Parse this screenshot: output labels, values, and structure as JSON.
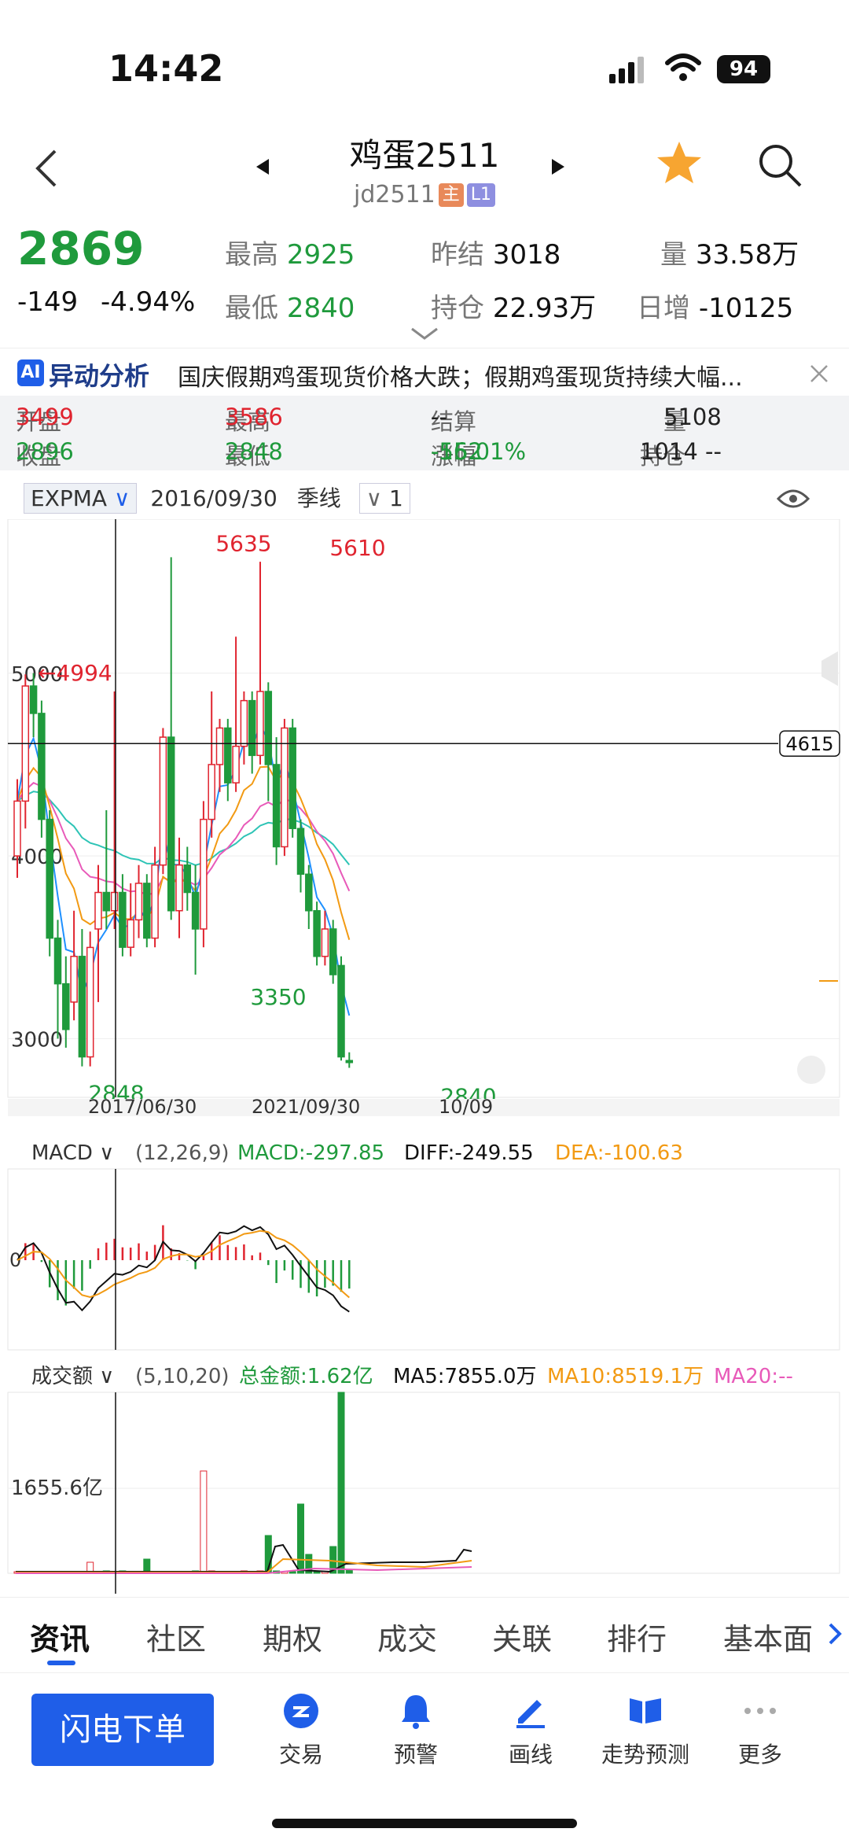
{
  "status_bar": {
    "time": "14:42",
    "battery": "94"
  },
  "header": {
    "title": "鸡蛋2511",
    "code": "jd2511",
    "tag_main": "主",
    "tag_l1": "L1"
  },
  "quote": {
    "price": "2869",
    "change": "-149",
    "change_pct": "-4.94%",
    "high_label": "最高",
    "high": "2925",
    "low_label": "最低",
    "low": "2840",
    "prev_settle_label": "昨结",
    "prev_settle": "3018",
    "open_interest_label": "持仓",
    "open_interest": "22.93万",
    "volume_label": "量",
    "volume": "33.58万",
    "daily_add_label": "日增",
    "daily_add": "-10125"
  },
  "news": {
    "ai_badge": "AI",
    "label": "异动分析",
    "text": "国庆假期鸡蛋现货价格大跌；假期鸡蛋现货持续大幅..."
  },
  "crosshair_stats": {
    "open_label": "开盘",
    "open": "3499",
    "high_label": "最高",
    "high": "3586",
    "settle_label": "结算",
    "settle": "--",
    "volume_label": "量",
    "volume": "5108",
    "close_label": "收盘",
    "close": "2896",
    "low_label": "最低",
    "low": "2848",
    "change_label": "涨幅",
    "change": "-552",
    "change_pct": "-16.01%",
    "oi_label": "持仓",
    "oi": "1014 --"
  },
  "chart_toolbar": {
    "indicator": "EXPMA",
    "date": "2016/09/30",
    "period": "季线",
    "multiplier": "1"
  },
  "chart_data": {
    "type": "candlestick",
    "title": "",
    "ylim": [
      2700,
      5800
    ],
    "y_ticks": [
      "5000",
      "4000",
      "3000"
    ],
    "x_ticks": [
      "2017/06/30",
      "2021/09/30",
      "10/09"
    ],
    "annotations": {
      "high1": "5635",
      "high2": "5610",
      "left_high": "4994",
      "mid_low": "3350",
      "left_low": "2848",
      "right_low": "2840",
      "crosshair_value": "4615"
    },
    "crosshair_value": 4615,
    "candles": [
      {
        "o": 4000,
        "c": 4300,
        "h": 4420,
        "l": 3880
      },
      {
        "o": 4300,
        "c": 4930,
        "h": 4994,
        "l": 4150
      },
      {
        "o": 4930,
        "c": 4780,
        "h": 5000,
        "l": 4650
      },
      {
        "o": 4780,
        "c": 4200,
        "h": 4850,
        "l": 4100
      },
      {
        "o": 4200,
        "c": 3550,
        "h": 4250,
        "l": 3450
      },
      {
        "o": 3550,
        "c": 3300,
        "h": 3650,
        "l": 3000
      },
      {
        "o": 3300,
        "c": 3050,
        "h": 3450,
        "l": 2950
      },
      {
        "o": 3200,
        "c": 3450,
        "h": 3700,
        "l": 3100
      },
      {
        "o": 3450,
        "c": 2900,
        "h": 3600,
        "l": 2848
      },
      {
        "o": 2900,
        "c": 3499,
        "h": 3586,
        "l": 2848
      },
      {
        "o": 3600,
        "c": 3800,
        "h": 3950,
        "l": 3200
      },
      {
        "o": 3800,
        "c": 3700,
        "h": 4250,
        "l": 3600
      },
      {
        "o": 3700,
        "c": 3800,
        "h": 4900,
        "l": 3600
      },
      {
        "o": 3800,
        "c": 3500,
        "h": 3900,
        "l": 3450
      },
      {
        "o": 3500,
        "c": 3650,
        "h": 3850,
        "l": 3450
      },
      {
        "o": 3650,
        "c": 3850,
        "h": 3950,
        "l": 3550
      },
      {
        "o": 3850,
        "c": 3550,
        "h": 3900,
        "l": 3500
      },
      {
        "o": 3550,
        "c": 3950,
        "h": 4050,
        "l": 3500
      },
      {
        "o": 3950,
        "c": 4650,
        "h": 4700,
        "l": 3900
      },
      {
        "o": 4650,
        "c": 3700,
        "h": 5635,
        "l": 3650
      },
      {
        "o": 3700,
        "c": 3950,
        "h": 4100,
        "l": 3550
      },
      {
        "o": 3950,
        "c": 3800,
        "h": 4050,
        "l": 3700
      },
      {
        "o": 3800,
        "c": 3600,
        "h": 3950,
        "l": 3350
      },
      {
        "o": 3600,
        "c": 4200,
        "h": 4300,
        "l": 3500
      },
      {
        "o": 4200,
        "c": 4500,
        "h": 4900,
        "l": 4100
      },
      {
        "o": 4500,
        "c": 4700,
        "h": 4750,
        "l": 4350
      },
      {
        "o": 4700,
        "c": 4400,
        "h": 4750,
        "l": 4300
      },
      {
        "o": 4400,
        "c": 4600,
        "h": 5200,
        "l": 4350
      },
      {
        "o": 4600,
        "c": 4850,
        "h": 4900,
        "l": 4500
      },
      {
        "o": 4850,
        "c": 4550,
        "h": 4900,
        "l": 4450
      },
      {
        "o": 4550,
        "c": 4900,
        "h": 5610,
        "l": 4500
      },
      {
        "o": 4900,
        "c": 4500,
        "h": 4950,
        "l": 4300
      },
      {
        "o": 4500,
        "c": 4050,
        "h": 4650,
        "l": 3950
      },
      {
        "o": 4050,
        "c": 4700,
        "h": 4750,
        "l": 4000
      },
      {
        "o": 4700,
        "c": 4150,
        "h": 4750,
        "l": 4100
      },
      {
        "o": 4150,
        "c": 3900,
        "h": 4200,
        "l": 3800
      },
      {
        "o": 3900,
        "c": 3700,
        "h": 3950,
        "l": 3600
      },
      {
        "o": 3700,
        "c": 3450,
        "h": 3750,
        "l": 3400
      },
      {
        "o": 3450,
        "c": 3600,
        "h": 3700,
        "l": 3400
      },
      {
        "o": 3600,
        "c": 3350,
        "h": 3650,
        "l": 3300
      },
      {
        "o": 3400,
        "c": 2900,
        "h": 3450,
        "l": 2880
      },
      {
        "o": 2880,
        "c": 2869,
        "h": 2925,
        "l": 2840
      }
    ]
  },
  "macd": {
    "label": "MACD",
    "params": "(12,26,9)",
    "macd": "MACD:-297.85",
    "diff": "DIFF:-249.55",
    "dea": "DEA:-100.63",
    "zero": "0"
  },
  "volume_panel": {
    "label": "成交额",
    "params": "(5,10,20)",
    "total": "总金额:1.62亿",
    "ma5": "MA5:7855.0万",
    "ma10": "MA10:8519.1万",
    "ma20": "MA20:--",
    "y_tick": "1655.6亿"
  },
  "tabs": [
    "资讯",
    "社区",
    "期权",
    "成交",
    "关联",
    "排行",
    "基本面"
  ],
  "bottom_nav": {
    "order": "闪电下单",
    "items": [
      "交易",
      "预警",
      "画线",
      "走势预测",
      "更多"
    ]
  },
  "colors": {
    "up": "#e0242f",
    "down": "#1f9a3c",
    "accent": "#1f5ee8"
  }
}
